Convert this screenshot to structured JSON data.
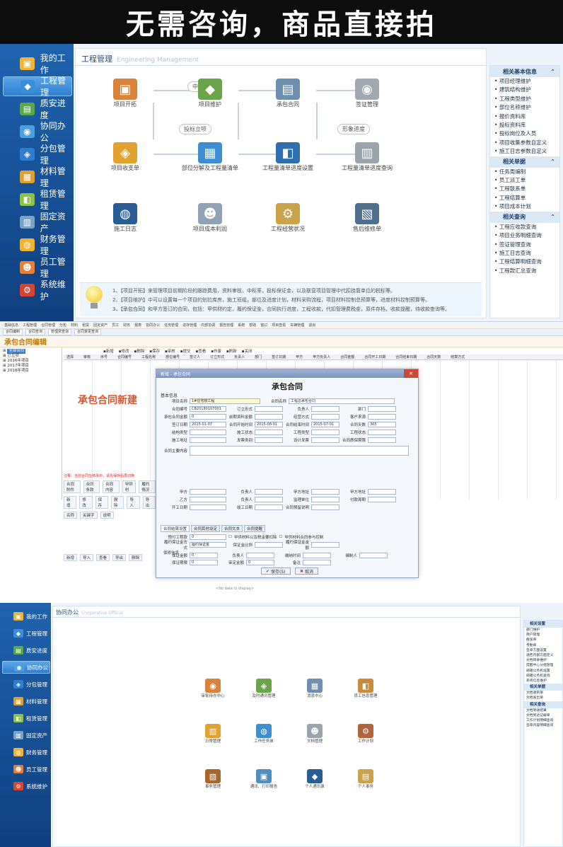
{
  "banner": {
    "title": "无需咨询，商品直接拍"
  },
  "screen1": {
    "sidebar": [
      {
        "label": "我的工作",
        "icon": "folder-icon",
        "color": "#f0b43a"
      },
      {
        "label": "工程管理",
        "icon": "engineer-icon",
        "color": "#3b8ed8",
        "active": true
      },
      {
        "label": "质安进度",
        "icon": "progress-icon",
        "color": "#5aa84a"
      },
      {
        "label": "协同办公",
        "icon": "office-icon",
        "color": "#4aa0e0"
      },
      {
        "label": "分包管理",
        "icon": "subcontract-icon",
        "color": "#2d7dd2"
      },
      {
        "label": "材料管理",
        "icon": "material-icon",
        "color": "#e0a030"
      },
      {
        "label": "租赁管理",
        "icon": "lease-icon",
        "color": "#8bc34a"
      },
      {
        "label": "固定资产",
        "icon": "asset-icon",
        "color": "#7aa2c8"
      },
      {
        "label": "财务管理",
        "icon": "finance-icon",
        "color": "#f2b233"
      },
      {
        "label": "员工管理",
        "icon": "staff-icon",
        "color": "#e57f3a"
      },
      {
        "label": "系统维护",
        "icon": "system-icon",
        "color": "#d94432"
      }
    ],
    "header": {
      "title": "工程管理",
      "subtitle": "Engineering Management"
    },
    "flow": [
      {
        "label": "项目开拓",
        "icon": "people-icon",
        "color": "#d9823a"
      },
      {
        "label": "项目维护",
        "icon": "building-icon",
        "color": "#6aa54a"
      },
      {
        "label": "承包合同",
        "icon": "contract-icon",
        "color": "#6f8fb0"
      },
      {
        "label": "签证管理",
        "icon": "visa-icon",
        "color": "#a0a8b2"
      },
      {
        "label": "项目收支单",
        "icon": "ledger-icon",
        "color": "#e2a230"
      },
      {
        "label": "部位分解及工程量清单",
        "icon": "blocks-icon",
        "color": "#3d8fd1"
      },
      {
        "label": "工程量清单进度设置",
        "icon": "clock-icon",
        "color": "#2f6fb0"
      },
      {
        "label": "工程量清单进度查询",
        "icon": "clock-query-icon",
        "color": "#9aa4ad"
      },
      {
        "label": "施工日志",
        "icon": "book-icon",
        "color": "#2a5d93"
      },
      {
        "label": "项目成本利润",
        "icon": "document-icon",
        "color": "#8fa2b6"
      },
      {
        "label": "工程经营状况",
        "icon": "chart-icon",
        "color": "#c9a24a"
      },
      {
        "label": "售后维修单",
        "icon": "service-icon",
        "color": "#4f6f8f"
      }
    ],
    "flow_tags": {
      "zhongbiao": "中标",
      "tender": "投标立项",
      "progress": "形象进度"
    },
    "tips": [
      "1、【项目开拓】来管理项目前期阶段的跟踪费用，资料审核，中标率，投标保证金，以及联营项目管理中代扣挂靠单位的税标等。",
      "2、【项目维护】中可以设置每一个项目的划拉库房，施工班组，部位及进度计划，材料采购流程，项目材料控制总预算等，进度材料控制预算等。",
      "3、【承包合同】和甲方签订的合同，包括：甲供材约定，履约保证金，合同执行进度，工程收款，代扣管理费税金，原件存档，收款提醒，待收款查询等。"
    ],
    "right_panel": [
      {
        "title": "相关基本信息",
        "items": [
          "项目经理维护",
          "建筑结构维护",
          "工程类型维护",
          "部位名称维护",
          "报价资料库",
          "投标资料库",
          "投标岗位及人员",
          "项目收集参数自定义",
          "施工日志参数自定义"
        ]
      },
      {
        "title": "相关单据",
        "items": [
          "任务周编制",
          "员工派工单",
          "工程联系单",
          "工程结算单",
          "项目成本计划"
        ]
      },
      {
        "title": "相关查询",
        "items": [
          "工程应收款查询",
          "项目业务明细查询",
          "签证管理查询",
          "施工日志查询",
          "工程结算明细查询",
          "工程款汇总查询"
        ]
      }
    ]
  },
  "screen2": {
    "menubar": [
      "基础信息",
      "工程管理",
      "合同管理",
      "分包",
      "材料",
      "租赁",
      "固定资产",
      "员工",
      "财务",
      "报表",
      "协同办公",
      "任务管理",
      "进存管理",
      "内部协调",
      "报告管理",
      "系统",
      "帮助",
      "窗口",
      "项目查看",
      "车辆管理",
      "退出"
    ],
    "tabs": [
      "合同编制",
      "合同查询",
      "管理费查询",
      "合同变更查询"
    ],
    "title": "承包合同编辑",
    "toolbar": [
      "新增",
      "修改",
      "删除",
      "保存",
      "审核",
      "提交",
      "查看",
      "作废",
      "刷新",
      "关闭"
    ],
    "tree": [
      "全部合同",
      "已立项",
      "2016年项目",
      "2017年项目",
      "2018年项目"
    ],
    "grid_headers": [
      "选择",
      "审核",
      "序号",
      "合同编号",
      "工程名称",
      "部位编号",
      "签订人",
      "订立形式",
      "负责人",
      "部门",
      "签订日期",
      "甲方",
      "甲方负责人",
      "合同金额",
      "合同开工日期",
      "合同结束日期",
      "合同天数",
      "结算方式"
    ],
    "red_label": "承包合同新建",
    "status_text": "注释：当前合同在修改中，请先保存后再切换",
    "bottom_tabs": [
      "合同附件",
      "合同条款",
      "合同内容",
      "甲供材",
      "履约情况"
    ],
    "bottom_toolbar": [
      "新增",
      "修改",
      "保存",
      "删除",
      "导入",
      "导出"
    ],
    "bottom_headers": [
      "名称",
      "关键字",
      "说明"
    ],
    "bottom_row": [
      "新增",
      "导入",
      "查看",
      "导出",
      "删除"
    ],
    "nodata": "<No data to display>",
    "dialog": {
      "window_title": "新增 - 承包合同",
      "heading": "承包合同",
      "section_basic": "基本信息",
      "fields": [
        {
          "label": "项目名称",
          "value": "1#住宅楼工程",
          "hi": true,
          "label2": "合同名称",
          "value2": "工程总承包合同"
        },
        {
          "label": "合同编号",
          "value": "CB20180107001",
          "label2": "订立形式",
          "value2": "",
          "label3": "负责人",
          "value3": "",
          "label4": "部门",
          "value4": ""
        },
        {
          "label": "承包合同金额",
          "value": "0",
          "label2": "前期资料金额",
          "value2": "",
          "label3": "经营方式",
          "value3": "",
          "label4": "客户来源",
          "value4": ""
        },
        {
          "label": "签订日期",
          "value": "2015-01-07",
          "label2": "合同开始时间",
          "value2": "2015-08-01",
          "label3": "合同结束时间",
          "value3": "2015-07-01",
          "label4": "合同天数",
          "value4": "365"
        },
        {
          "label": "结构类型",
          "value": "",
          "label2": "施工状态",
          "value2": "",
          "label3": "工程类型",
          "value3": "",
          "label4": "工程状态",
          "value4": ""
        },
        {
          "label": "施工地址",
          "value": "",
          "label2": "发票类别",
          "value2": "",
          "label3": "设计发票",
          "value3": "",
          "label4": "合同质保期限",
          "value4": ""
        }
      ],
      "contract_scope_label": "合同主要内容",
      "party_rows": [
        {
          "label": "甲方",
          "value": "",
          "label2": "负责人",
          "value2": "",
          "label3": "甲方地址",
          "value3": "",
          "label4": "甲方地址",
          "value4": ""
        },
        {
          "label": "乙方",
          "value": "",
          "label2": "负责人",
          "value2": "",
          "label3": "监理单位",
          "value3": "",
          "label4": "付款周期",
          "value4": ""
        },
        {
          "label": "开工日期",
          "value": "",
          "label2": "竣工日期",
          "value2": "",
          "label3": "合同预留说明",
          "value3": ""
        }
      ],
      "tabs": [
        "合同结算设置",
        "合同其他设定",
        "合同文本",
        "合同提醒"
      ],
      "tab_fields": [
        {
          "label": "预付工程款",
          "value": "0",
          "check": "甲供材料以及税金要扣除",
          "check2": "甲供材料合同参与控制"
        },
        {
          "label": "履约保证金方式",
          "value": "履约保证金",
          "label2": "保证金比例",
          "value2": "",
          "label3": "履约保证金金额",
          "value3": ""
        }
      ],
      "groups": [
        "保修信息",
        "质量保证",
        "安全信息"
      ],
      "group_rows": [
        {
          "label": "保证金额",
          "value": "0",
          "label2": "负责人",
          "value2": "",
          "label3": "缴纳时间",
          "value3": "",
          "label4": "编制人",
          "value4": ""
        },
        {
          "label": "保证期限",
          "value": "0",
          "label2": "审定金额",
          "value2": "0",
          "label3": "备注",
          "value3": ""
        },
        {
          "label": "质量金额",
          "value": "0",
          "label2": "负责人",
          "value2": "",
          "label3": "缴纳时间",
          "value3": "",
          "label4": "编制人",
          "value4": ""
        },
        {
          "label": "保证期限",
          "value": "0",
          "label2": "审定金额",
          "value2": "0",
          "label3": "备注",
          "value3": ""
        },
        {
          "label": "安全金额",
          "value": "0",
          "label2": "审定金额",
          "value2": "0",
          "label3": "备注",
          "value3": ""
        }
      ],
      "save_label": "保存(S)",
      "cancel_label": "取消"
    }
  },
  "screen3": {
    "sidebar": [
      {
        "label": "我的工作",
        "color": "#f0b43a"
      },
      {
        "label": "工程管理",
        "color": "#3b8ed8"
      },
      {
        "label": "质安进度",
        "color": "#5aa84a"
      },
      {
        "label": "协同办公",
        "color": "#4aa0e0",
        "active": true
      },
      {
        "label": "分包管理",
        "color": "#2d7dd2"
      },
      {
        "label": "材料管理",
        "color": "#e0a030"
      },
      {
        "label": "租赁管理",
        "color": "#8bc34a"
      },
      {
        "label": "固定资产",
        "color": "#7aa2c8"
      },
      {
        "label": "财务管理",
        "color": "#f2b233"
      },
      {
        "label": "员工管理",
        "color": "#e57f3a"
      },
      {
        "label": "系统维护",
        "color": "#d94432"
      }
    ],
    "header": {
      "title": "协同办公",
      "subtitle": "Cooperative Official"
    },
    "nodes": [
      {
        "label": "审批待办中心",
        "color": "#d9823a"
      },
      {
        "label": "及时通讯管理",
        "color": "#6aa54a"
      },
      {
        "label": "消息中心",
        "color": "#6f8fb0"
      },
      {
        "label": "员工信息管理",
        "color": "#c98c3a"
      },
      {
        "label": "日常管理",
        "color": "#e2a230"
      },
      {
        "label": "工作任务单",
        "color": "#3d8fd1"
      },
      {
        "label": "文档管理",
        "color": "#9aa4ad"
      },
      {
        "label": "工作计划",
        "color": "#b0653a"
      },
      {
        "label": "事务管理",
        "color": "#a8662a"
      },
      {
        "label": "通讯、打印报告",
        "color": "#4f8fbf"
      },
      {
        "label": "个人通讯录",
        "color": "#2a5d93"
      },
      {
        "label": "个人事务",
        "color": "#c9a24a"
      }
    ],
    "right_panel": [
      {
        "title": "相关设置",
        "items": [
          "部门维护",
          "用户管理",
          "群发单",
          "考勤单",
          "签章方面设置",
          "通告内部方面定义",
          "文档目录维护",
          "提醒中心分组管理",
          "邮箱公务机设置",
          "邮箱公务机查询",
          "系统信息维护"
        ]
      },
      {
        "title": "相关单据",
        "items": [
          "文档收到单",
          "文档发出单"
        ]
      },
      {
        "title": "相关查询",
        "items": [
          "文档到收结果",
          "文档到达记载单",
          "工作计划明细查询",
          "签章内容明细查询"
        ]
      }
    ]
  }
}
